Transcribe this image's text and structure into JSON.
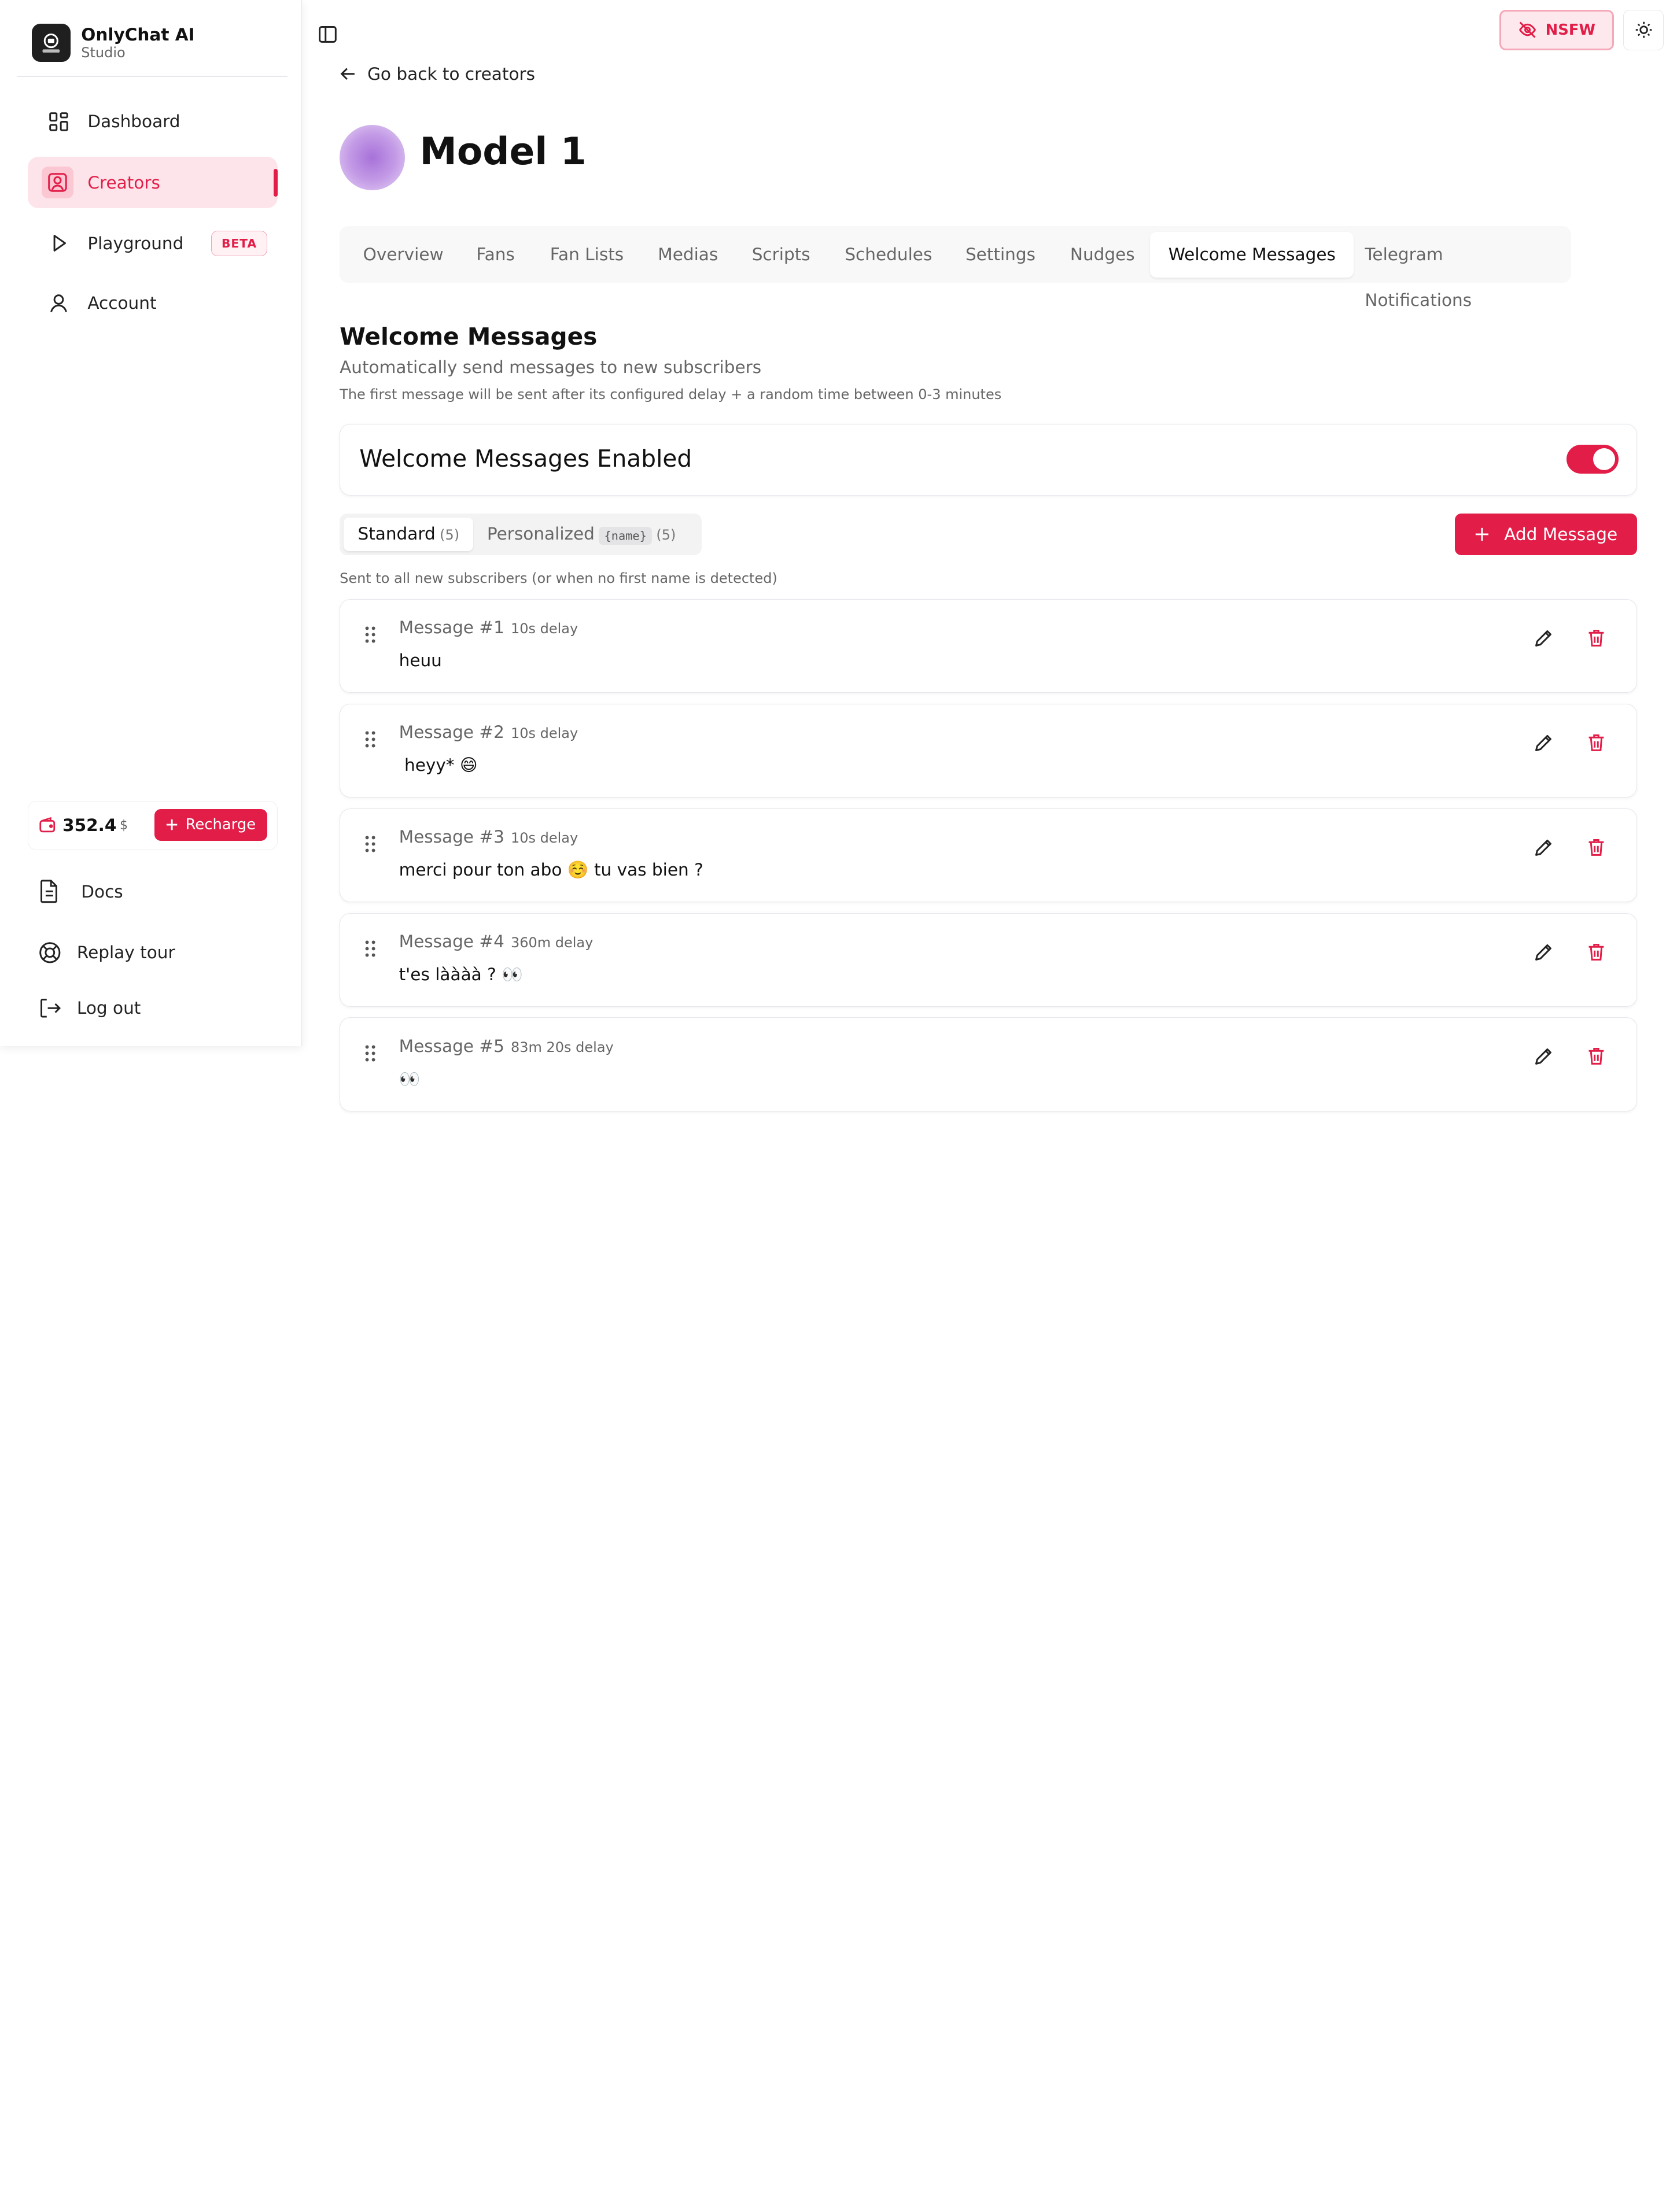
{
  "brand": {
    "name": "OnlyChat AI",
    "subtitle": "Studio"
  },
  "sidebar": {
    "nav": [
      {
        "label": "Dashboard",
        "icon": "dashboard-icon"
      },
      {
        "label": "Creators",
        "icon": "user-square-icon",
        "active": true
      },
      {
        "label": "Playground",
        "icon": "play-icon",
        "badge": "BETA"
      },
      {
        "label": "Account",
        "icon": "user-icon"
      }
    ],
    "wallet": {
      "amount": "352.4",
      "currency": "$",
      "recharge_label": "Recharge"
    },
    "bottom": [
      {
        "label": "Docs",
        "icon": "document-icon"
      },
      {
        "label": "Replay tour",
        "icon": "lifebuoy-icon"
      },
      {
        "label": "Log out",
        "icon": "logout-icon"
      }
    ]
  },
  "header": {
    "nsfw_label": "NSFW"
  },
  "back_link": "Go back to creators",
  "creator": {
    "name": "Model 1"
  },
  "tabs": [
    "Overview",
    "Fans",
    "Fan Lists",
    "Medias",
    "Scripts",
    "Schedules",
    "Settings",
    "Nudges",
    "Welcome Messages",
    "Telegram Notifications"
  ],
  "active_tab": "Welcome Messages",
  "section": {
    "title": "Welcome Messages",
    "subtitle": "Automatically send messages to new subscribers",
    "note": "The first message will be sent after its configured delay + a random time between 0-3 minutes"
  },
  "toggle": {
    "label": "Welcome Messages Enabled",
    "enabled": true
  },
  "subtabs": {
    "standard": {
      "label": "Standard",
      "count": "(5)"
    },
    "personalized": {
      "label": "Personalized",
      "tag": "{name}",
      "count": "(5)"
    }
  },
  "add_button": "Add Message",
  "list_description": "Sent to all new subscribers (or when no first name is detected)",
  "messages": [
    {
      "title": "Message #1",
      "delay": "10s delay",
      "text": "heuu"
    },
    {
      "title": "Message #2",
      "delay": "10s delay",
      "text": " heyy* 😄"
    },
    {
      "title": "Message #3",
      "delay": "10s delay",
      "text": "merci pour ton abo ☺️ tu vas bien ?"
    },
    {
      "title": "Message #4",
      "delay": "360m delay",
      "text": "t'es làààà ? 👀"
    },
    {
      "title": "Message #5",
      "delay": "83m 20s delay",
      "text": "👀"
    }
  ],
  "colors": {
    "accent": "#e11d48",
    "accent_light": "#fde4ea",
    "muted": "#666666"
  }
}
